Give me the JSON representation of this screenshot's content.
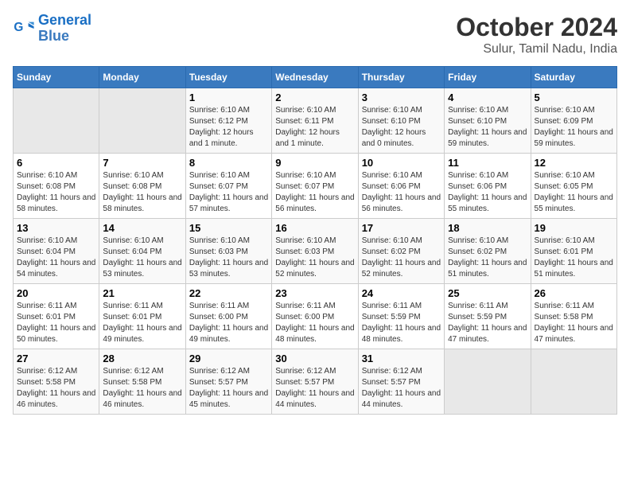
{
  "header": {
    "logo_line1": "General",
    "logo_line2": "Blue",
    "title": "October 2024",
    "subtitle": "Sulur, Tamil Nadu, India"
  },
  "weekdays": [
    "Sunday",
    "Monday",
    "Tuesday",
    "Wednesday",
    "Thursday",
    "Friday",
    "Saturday"
  ],
  "weeks": [
    [
      {
        "day": "",
        "text": ""
      },
      {
        "day": "",
        "text": ""
      },
      {
        "day": "1",
        "text": "Sunrise: 6:10 AM\nSunset: 6:12 PM\nDaylight: 12 hours and 1 minute."
      },
      {
        "day": "2",
        "text": "Sunrise: 6:10 AM\nSunset: 6:11 PM\nDaylight: 12 hours and 1 minute."
      },
      {
        "day": "3",
        "text": "Sunrise: 6:10 AM\nSunset: 6:10 PM\nDaylight: 12 hours and 0 minutes."
      },
      {
        "day": "4",
        "text": "Sunrise: 6:10 AM\nSunset: 6:10 PM\nDaylight: 11 hours and 59 minutes."
      },
      {
        "day": "5",
        "text": "Sunrise: 6:10 AM\nSunset: 6:09 PM\nDaylight: 11 hours and 59 minutes."
      }
    ],
    [
      {
        "day": "6",
        "text": "Sunrise: 6:10 AM\nSunset: 6:08 PM\nDaylight: 11 hours and 58 minutes."
      },
      {
        "day": "7",
        "text": "Sunrise: 6:10 AM\nSunset: 6:08 PM\nDaylight: 11 hours and 58 minutes."
      },
      {
        "day": "8",
        "text": "Sunrise: 6:10 AM\nSunset: 6:07 PM\nDaylight: 11 hours and 57 minutes."
      },
      {
        "day": "9",
        "text": "Sunrise: 6:10 AM\nSunset: 6:07 PM\nDaylight: 11 hours and 56 minutes."
      },
      {
        "day": "10",
        "text": "Sunrise: 6:10 AM\nSunset: 6:06 PM\nDaylight: 11 hours and 56 minutes."
      },
      {
        "day": "11",
        "text": "Sunrise: 6:10 AM\nSunset: 6:06 PM\nDaylight: 11 hours and 55 minutes."
      },
      {
        "day": "12",
        "text": "Sunrise: 6:10 AM\nSunset: 6:05 PM\nDaylight: 11 hours and 55 minutes."
      }
    ],
    [
      {
        "day": "13",
        "text": "Sunrise: 6:10 AM\nSunset: 6:04 PM\nDaylight: 11 hours and 54 minutes."
      },
      {
        "day": "14",
        "text": "Sunrise: 6:10 AM\nSunset: 6:04 PM\nDaylight: 11 hours and 53 minutes."
      },
      {
        "day": "15",
        "text": "Sunrise: 6:10 AM\nSunset: 6:03 PM\nDaylight: 11 hours and 53 minutes."
      },
      {
        "day": "16",
        "text": "Sunrise: 6:10 AM\nSunset: 6:03 PM\nDaylight: 11 hours and 52 minutes."
      },
      {
        "day": "17",
        "text": "Sunrise: 6:10 AM\nSunset: 6:02 PM\nDaylight: 11 hours and 52 minutes."
      },
      {
        "day": "18",
        "text": "Sunrise: 6:10 AM\nSunset: 6:02 PM\nDaylight: 11 hours and 51 minutes."
      },
      {
        "day": "19",
        "text": "Sunrise: 6:10 AM\nSunset: 6:01 PM\nDaylight: 11 hours and 51 minutes."
      }
    ],
    [
      {
        "day": "20",
        "text": "Sunrise: 6:11 AM\nSunset: 6:01 PM\nDaylight: 11 hours and 50 minutes."
      },
      {
        "day": "21",
        "text": "Sunrise: 6:11 AM\nSunset: 6:01 PM\nDaylight: 11 hours and 49 minutes."
      },
      {
        "day": "22",
        "text": "Sunrise: 6:11 AM\nSunset: 6:00 PM\nDaylight: 11 hours and 49 minutes."
      },
      {
        "day": "23",
        "text": "Sunrise: 6:11 AM\nSunset: 6:00 PM\nDaylight: 11 hours and 48 minutes."
      },
      {
        "day": "24",
        "text": "Sunrise: 6:11 AM\nSunset: 5:59 PM\nDaylight: 11 hours and 48 minutes."
      },
      {
        "day": "25",
        "text": "Sunrise: 6:11 AM\nSunset: 5:59 PM\nDaylight: 11 hours and 47 minutes."
      },
      {
        "day": "26",
        "text": "Sunrise: 6:11 AM\nSunset: 5:58 PM\nDaylight: 11 hours and 47 minutes."
      }
    ],
    [
      {
        "day": "27",
        "text": "Sunrise: 6:12 AM\nSunset: 5:58 PM\nDaylight: 11 hours and 46 minutes."
      },
      {
        "day": "28",
        "text": "Sunrise: 6:12 AM\nSunset: 5:58 PM\nDaylight: 11 hours and 46 minutes."
      },
      {
        "day": "29",
        "text": "Sunrise: 6:12 AM\nSunset: 5:57 PM\nDaylight: 11 hours and 45 minutes."
      },
      {
        "day": "30",
        "text": "Sunrise: 6:12 AM\nSunset: 5:57 PM\nDaylight: 11 hours and 44 minutes."
      },
      {
        "day": "31",
        "text": "Sunrise: 6:12 AM\nSunset: 5:57 PM\nDaylight: 11 hours and 44 minutes."
      },
      {
        "day": "",
        "text": ""
      },
      {
        "day": "",
        "text": ""
      }
    ]
  ]
}
